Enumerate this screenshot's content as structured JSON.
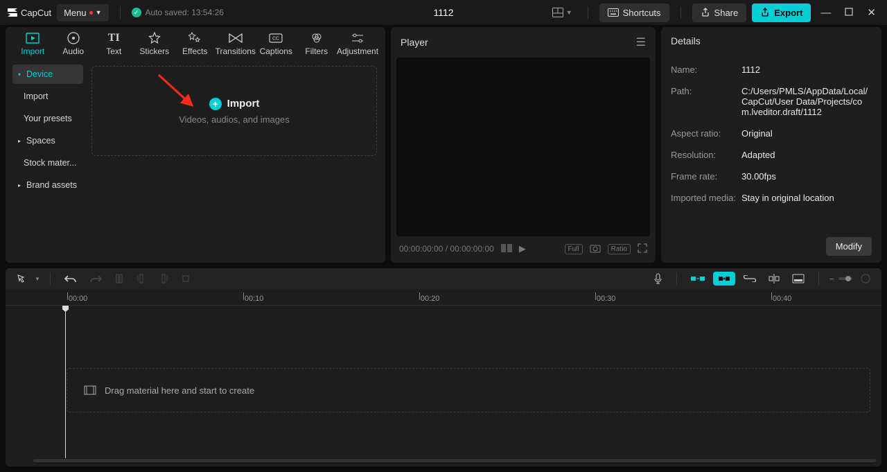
{
  "app": {
    "name": "CapCut",
    "menu_label": "Menu",
    "auto_saved": "Auto saved: 13:54:26",
    "doc_title": "1112"
  },
  "topright": {
    "shortcuts": "Shortcuts",
    "share": "Share",
    "export": "Export"
  },
  "tabs": [
    "Import",
    "Audio",
    "Text",
    "Stickers",
    "Effects",
    "Transitions",
    "Captions",
    "Filters",
    "Adjustment"
  ],
  "sidebar": {
    "device": "Device",
    "import": "Import",
    "presets": "Your presets",
    "spaces": "Spaces",
    "stock": "Stock mater...",
    "brand": "Brand assets"
  },
  "import_drop": {
    "label": "Import",
    "sub": "Videos, audios, and images"
  },
  "player": {
    "title": "Player",
    "time_left": "00:00:00:00",
    "time_right": "00:00:00:00",
    "full": "Full",
    "ratio": "Ratio"
  },
  "details": {
    "title": "Details",
    "name_label": "Name:",
    "name": "1112",
    "path_label": "Path:",
    "path": "C:/Users/PMLS/AppData/Local/CapCut/User Data/Projects/com.lveditor.draft/1112",
    "aspect_label": "Aspect ratio:",
    "aspect": "Original",
    "res_label": "Resolution:",
    "res": "Adapted",
    "fps_label": "Frame rate:",
    "fps": "30.00fps",
    "imported_label": "Imported media:",
    "imported": "Stay in original location",
    "modify": "Modify"
  },
  "timeline": {
    "drop_hint": "Drag material here and start to create",
    "ticks": [
      "00:00",
      "00:10",
      "00:20",
      "00:30",
      "00:40"
    ]
  }
}
